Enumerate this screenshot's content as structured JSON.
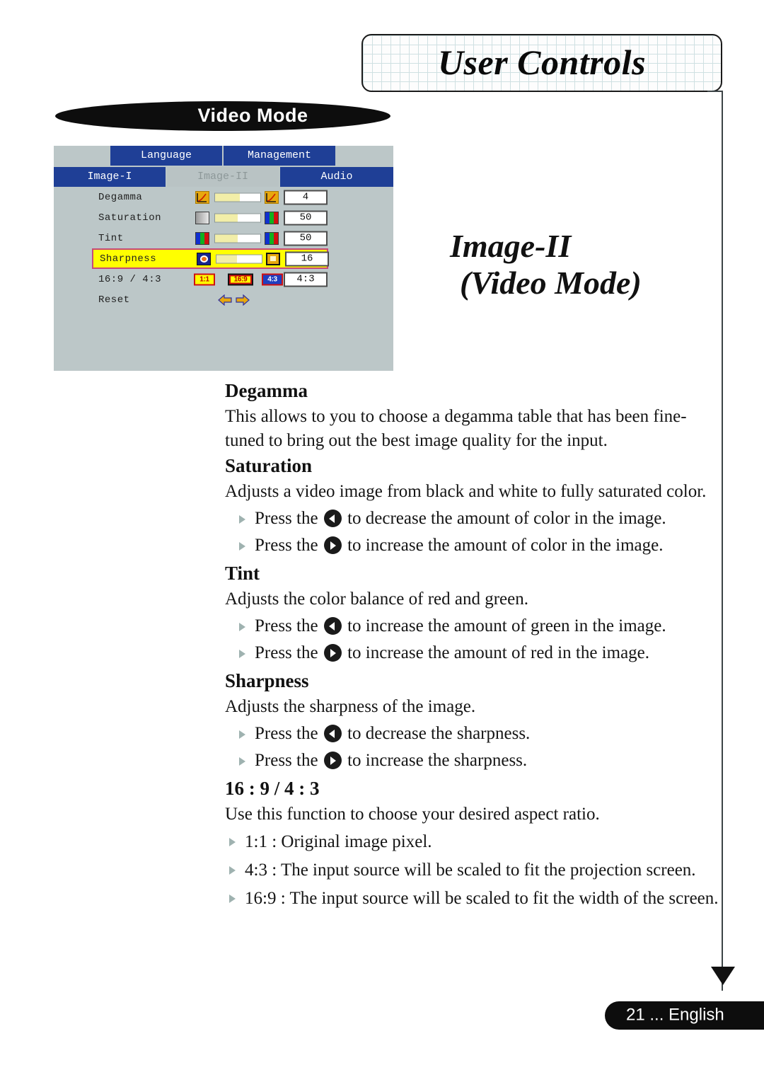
{
  "header": {
    "title": "User Controls",
    "banner_label": "Video Mode"
  },
  "section": {
    "title_line1": "Image-II",
    "title_line2": "(Video Mode)"
  },
  "osd": {
    "tabs_top": [
      {
        "label": "Language",
        "active": false
      },
      {
        "label": "Management",
        "active": false
      }
    ],
    "tabs_bottom": [
      {
        "label": "Image-I",
        "active": false
      },
      {
        "label": "Image-II",
        "active": true
      },
      {
        "label": "Audio",
        "active": false
      }
    ],
    "rows": [
      {
        "label": "Degamma",
        "value": "4",
        "fill_percent": 55,
        "highlighted": false
      },
      {
        "label": "Saturation",
        "value": "50",
        "fill_percent": 50,
        "highlighted": false
      },
      {
        "label": "Tint",
        "value": "50",
        "fill_percent": 50,
        "highlighted": false
      },
      {
        "label": "Sharpness",
        "value": "16",
        "fill_percent": 45,
        "highlighted": true
      }
    ],
    "aspect_row": {
      "label": "16:9 / 4:3",
      "options": [
        "1:1",
        "16:9",
        "4:3"
      ],
      "value": "4:3"
    },
    "reset_row": {
      "label": "Reset"
    },
    "colors": {
      "panel_bg": "#bcc7c8",
      "tab_blue": "#1f3f96",
      "highlight_yellow": "#ffff00",
      "highlight_border": "#c84878",
      "slider_fill": "#f2eea8"
    }
  },
  "content": {
    "degamma": {
      "heading": "Degamma",
      "paragraphs": [
        "This allows to you to choose a degamma table that has been fine-tuned to bring out the best image quality for the input."
      ],
      "bullets": []
    },
    "saturation": {
      "heading": "Saturation",
      "paragraphs": [
        "Adjusts a video image from black and white to fully saturated color."
      ],
      "bullet_prefix": "Press the",
      "bullets": [
        {
          "arrow": "left",
          "text": "to decrease the amount of color in the image."
        },
        {
          "arrow": "right",
          "text": "to increase the amount of color in the image."
        }
      ]
    },
    "tint": {
      "heading": "Tint",
      "paragraphs": [
        "Adjusts the color balance of red and green."
      ],
      "bullet_prefix": "Press the",
      "bullets": [
        {
          "arrow": "left",
          "text": "to increase the amount of green in the image."
        },
        {
          "arrow": "right",
          "text": "to increase the amount of red  in the image."
        }
      ]
    },
    "sharpness": {
      "heading": "Sharpness",
      "paragraphs": [
        "Adjusts the sharpness of the image."
      ],
      "bullet_prefix": "Press the",
      "bullets": [
        {
          "arrow": "left",
          "text": "to decrease the sharpness."
        },
        {
          "arrow": "right",
          "text": "to increase the sharpness."
        }
      ]
    },
    "aspect": {
      "heading": "16 : 9 / 4 : 3",
      "paragraphs": [
        "Use this function to choose your desired aspect ratio."
      ],
      "bullets": [
        "1:1 : Original image pixel.",
        "4:3 : The input source will be scaled to fit the projection screen.",
        "16:9 : The input source will be scaled to fit the width of the screen."
      ]
    }
  },
  "footer": {
    "page_number": "21",
    "text": "21  ... English"
  }
}
